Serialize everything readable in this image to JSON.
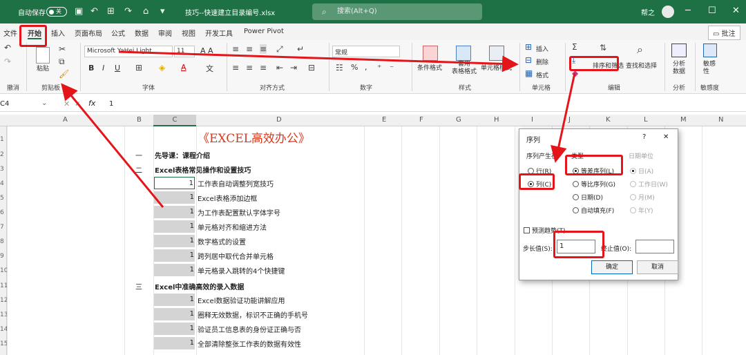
{
  "titlebar": {
    "autosave": "自动保存",
    "toggle": "关",
    "filename": "技巧--快速建立目录编号.xlsx",
    "search_placeholder": "搜索(Alt+Q)",
    "user": "帮之",
    "comment_btn": "批注"
  },
  "menu": [
    "文件",
    "开始",
    "插入",
    "页面布局",
    "公式",
    "数据",
    "审阅",
    "视图",
    "开发工具",
    "Power Pivot"
  ],
  "ribbon": {
    "groups": {
      "undo": "撤消",
      "clipboard": "剪贴板",
      "font": "字体",
      "align": "对齐方式",
      "number": "数字",
      "styles": "样式",
      "cells": "单元格",
      "edit": "编辑",
      "analyze": "分析",
      "sensitivity": "敏感度"
    },
    "paste": "粘贴",
    "font_name": "Microsoft YaHei Light",
    "font_size": "11",
    "number_format": "常规",
    "cond_fmt": "条件格式",
    "table_fmt": "套用\n表格格式",
    "cell_style": "单元格样式",
    "insert": "插入",
    "delete": "删除",
    "format": "格式",
    "sort": "排序和筛选",
    "find": "查找和选择",
    "analyze_data": "分析\n数据",
    "sensitivity_btn": "敏感\n性"
  },
  "formula": {
    "namebox": "C4",
    "value": "1"
  },
  "columns": [
    "A",
    "B",
    "C",
    "D",
    "E",
    "F",
    "G",
    "H",
    "I",
    "J",
    "K",
    "L",
    "M",
    "N"
  ],
  "rows": [
    "1",
    "2",
    "3",
    "4",
    "5",
    "6",
    "7",
    "8",
    "9",
    "10",
    "11",
    "12",
    "13",
    "14",
    "15"
  ],
  "sheet": {
    "title": "《EXCEL高效办公》",
    "b2": "一",
    "d2": "先导课：课程介绍",
    "b3": "二",
    "d3": "Excel表格常见操作和设置技巧",
    "c_values": [
      "1",
      "1",
      "1",
      "1",
      "1",
      "1",
      "1"
    ],
    "items3": [
      "工作表自动调整列宽技巧",
      "Excel表格添加边框",
      "为工作表配置默认字体字号",
      "单元格对齐和缩进方法",
      "数字格式的设置",
      "跨列居中取代合并单元格",
      "单元格录入跳转的4个快捷键"
    ],
    "b11": "三",
    "d11": "Excel中准确高效的录入数据",
    "c_values2": [
      "1",
      "1",
      "1",
      "1"
    ],
    "items11": [
      "Excel数据验证功能讲解应用",
      "圈释无效数据，标识不正确的手机号",
      "验证员工信息表的身份证正确与否",
      "全部清除整张工作表的数据有效性"
    ]
  },
  "dialog": {
    "title": "序列",
    "help": "?",
    "close": "✕",
    "series_in": "序列产生在",
    "row": "行(R)",
    "col": "列(C)",
    "type": "类型",
    "linear": "等差序列(L)",
    "growth": "等比序列(G)",
    "date": "日期(D)",
    "autofill": "自动填充(F)",
    "date_unit": "日期单位",
    "day": "日(A)",
    "weekday": "工作日(W)",
    "month": "月(M)",
    "year": "年(Y)",
    "trend": "预测趋势(T)",
    "step_label": "步长值(S):",
    "step_value": "1",
    "stop_label": "终止值(O):",
    "stop_value": "",
    "ok": "确定",
    "cancel": "取消"
  }
}
